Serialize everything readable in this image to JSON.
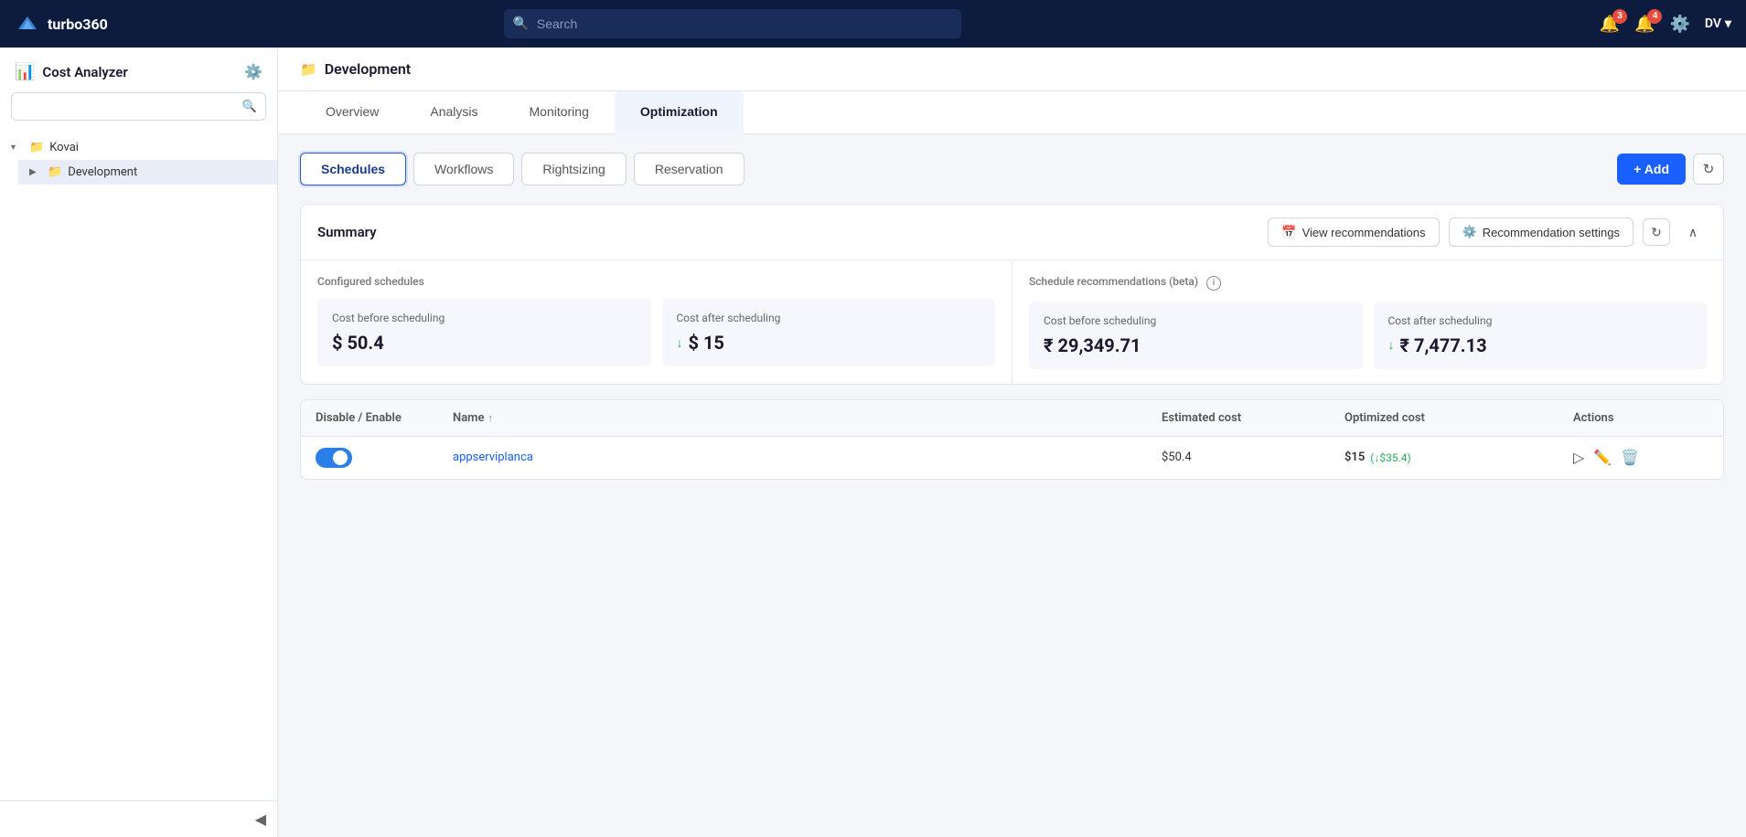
{
  "topnav": {
    "logo_text": "turbo360",
    "search_placeholder": "Search",
    "notification_badge": "3",
    "alert_badge": "4",
    "user_initials": "DV"
  },
  "sidebar": {
    "title": "Cost Analyzer",
    "search_placeholder": "",
    "tree": [
      {
        "id": "kovai",
        "label": "Kovai",
        "level": 0,
        "expanded": true,
        "chevron": "▾"
      },
      {
        "id": "development",
        "label": "Development",
        "level": 1,
        "active": true,
        "chevron": "▶"
      }
    ],
    "collapse_icon": "◀"
  },
  "page": {
    "breadcrumb_icon": "📁",
    "title": "Development",
    "tabs": [
      {
        "id": "overview",
        "label": "Overview",
        "active": false
      },
      {
        "id": "analysis",
        "label": "Analysis",
        "active": false
      },
      {
        "id": "monitoring",
        "label": "Monitoring",
        "active": false
      },
      {
        "id": "optimization",
        "label": "Optimization",
        "active": true
      }
    ],
    "subtabs": [
      {
        "id": "schedules",
        "label": "Schedules",
        "active": true
      },
      {
        "id": "workflows",
        "label": "Workflows",
        "active": false
      },
      {
        "id": "rightsizing",
        "label": "Rightsizing",
        "active": false
      },
      {
        "id": "reservation",
        "label": "Reservation",
        "active": false
      }
    ],
    "add_button": "+ Add",
    "summary": {
      "title": "Summary",
      "view_recommendations_label": "View recommendations",
      "recommendation_settings_label": "Recommendation settings",
      "configured_schedules_title": "Configured schedules",
      "schedule_recommendations_title": "Schedule recommendations (beta)",
      "cost_before_scheduling_label": "Cost before scheduling",
      "cost_after_scheduling_label": "Cost after scheduling",
      "configured_cost_before": "$ 50.4",
      "configured_cost_after": "$ 15",
      "recommended_cost_before": "₹ 29,349.71",
      "recommended_cost_after": "₹ 7,477.13"
    },
    "table": {
      "columns": [
        {
          "id": "disable_enable",
          "label": "Disable / Enable"
        },
        {
          "id": "name",
          "label": "Name",
          "sortable": true
        },
        {
          "id": "estimated_cost",
          "label": "Estimated cost"
        },
        {
          "id": "optimized_cost",
          "label": "Optimized cost"
        },
        {
          "id": "actions",
          "label": "Actions"
        }
      ],
      "rows": [
        {
          "enabled": true,
          "name": "appserviplanca",
          "estimated_cost": "$50.4",
          "optimized_cost_main": "$15",
          "optimized_cost_diff": "(↓$35.4)"
        }
      ]
    }
  }
}
